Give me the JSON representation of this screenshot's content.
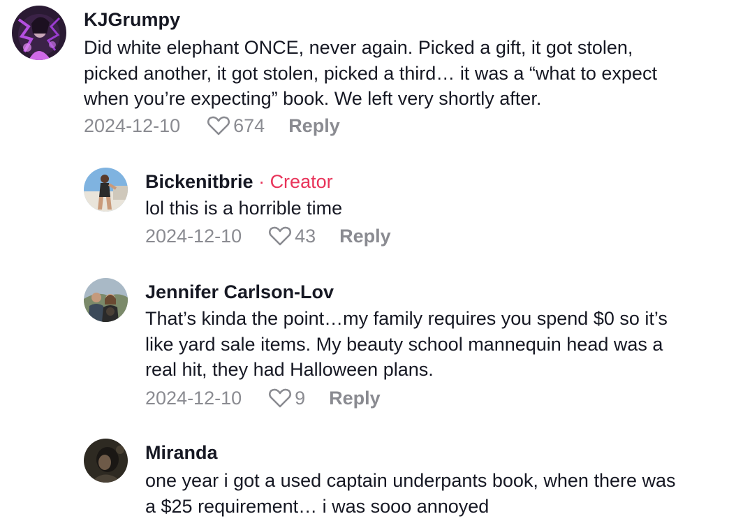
{
  "comments": [
    {
      "username": "KJGrumpy",
      "text": "Did white elephant ONCE, never again. Picked a gift, it got stolen,\npicked another, it got stolen, picked a third… it was a “what to expect\nwhen you’re expecting” book. We left very shortly after.",
      "date": "2024-12-10",
      "likes": "674",
      "reply_label": "Reply"
    },
    {
      "username": "Bickenitbrie",
      "creator_sep": " · ",
      "creator_label": "Creator",
      "text": "lol this is a horrible time",
      "date": "2024-12-10",
      "likes": "43",
      "reply_label": "Reply"
    },
    {
      "username": "Jennifer Carlson-Lov",
      "text": "That’s kinda the point…my family requires you spend $0 so it’s\nlike yard sale items. My beauty school mannequin head was a\nreal hit, they had Halloween plans.",
      "date": "2024-12-10",
      "likes": "9",
      "reply_label": "Reply"
    },
    {
      "username": "Miranda",
      "text": "one year i got a used captain underpants book, when there was\na $25 requirement… i was sooo annoyed"
    }
  ],
  "colors": {
    "creator": "#e8345a",
    "meta": "#8a8b91",
    "text": "#161823"
  },
  "icons": {
    "like": "heart-outline-icon"
  }
}
